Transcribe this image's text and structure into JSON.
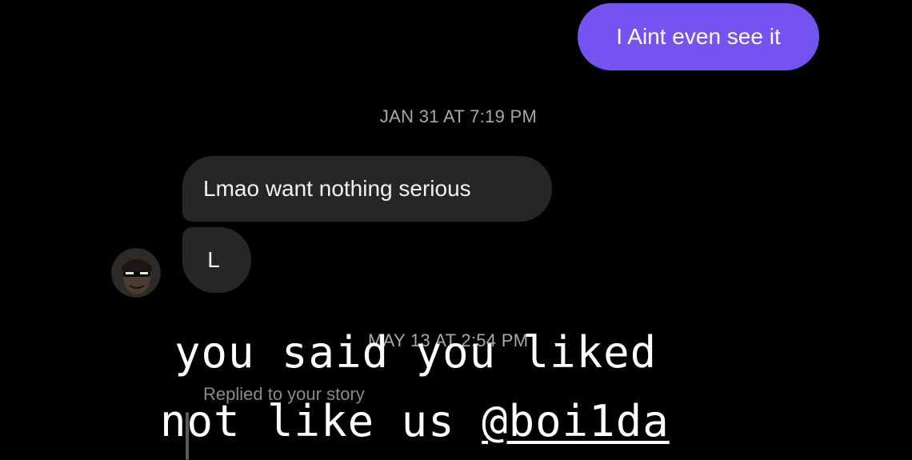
{
  "thread": {
    "sent_message": "I Aint even see it",
    "timestamp_1": "JAN 31 AT 7:19 PM",
    "received_messages": [
      "Lmao want nothing serious",
      "L"
    ],
    "timestamp_2": "MAY 13 AT 2:54 PM",
    "reply_context": "Replied to your story"
  },
  "overlay_caption": {
    "line1": "you said you liked",
    "line2_text": "not like us ",
    "line2_mention": "@boi1da"
  },
  "colors": {
    "background": "#000000",
    "sent_bubble": "#7453f0",
    "received_bubble": "#262626",
    "timestamp": "#a8a8a8"
  },
  "icons": {
    "avatar": "user-avatar"
  }
}
